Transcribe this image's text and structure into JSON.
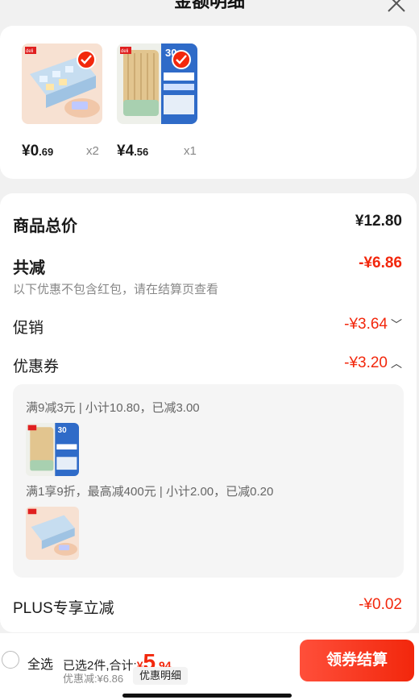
{
  "header": {
    "title": "金额明细"
  },
  "products": [
    {
      "price_int": "¥0",
      "price_dec": ".69",
      "qty": "x2",
      "brand": "deli",
      "image": "eraser-pack"
    },
    {
      "price_int": "¥4",
      "price_dec": ".56",
      "qty": "x1",
      "brand": "deli",
      "image": "pencil-tube"
    }
  ],
  "summary": {
    "total_label": "商品总价",
    "total_value": "¥12.80",
    "reduce_label": "共减",
    "reduce_value": "-¥6.86",
    "note": "以下优惠不包含红包，请在结算页查看",
    "promo_label": "促销",
    "promo_value": "-¥3.64",
    "coupon_label": "优惠券",
    "coupon_value": "-¥3.20",
    "coupons": [
      {
        "text": "满9减3元 | 小计10.80，已减3.00",
        "image": "pencil-tube"
      },
      {
        "text": "满1享9折，最高减400元 | 小计2.00，已减0.20",
        "image": "eraser-pack"
      }
    ],
    "plus_label": "PLUS专享立减",
    "plus_value": "-¥0.02"
  },
  "footer": {
    "select_all": "全选",
    "selected_prefix": "已选2件,合计:",
    "total_yen": "¥",
    "total_int": "5",
    "total_dec": ".94",
    "discount": "优惠减:¥6.86",
    "detail_btn": "优惠明细",
    "checkout_btn": "领券结算"
  },
  "colors": {
    "accent": "#f2270c",
    "muted": "#888888"
  }
}
